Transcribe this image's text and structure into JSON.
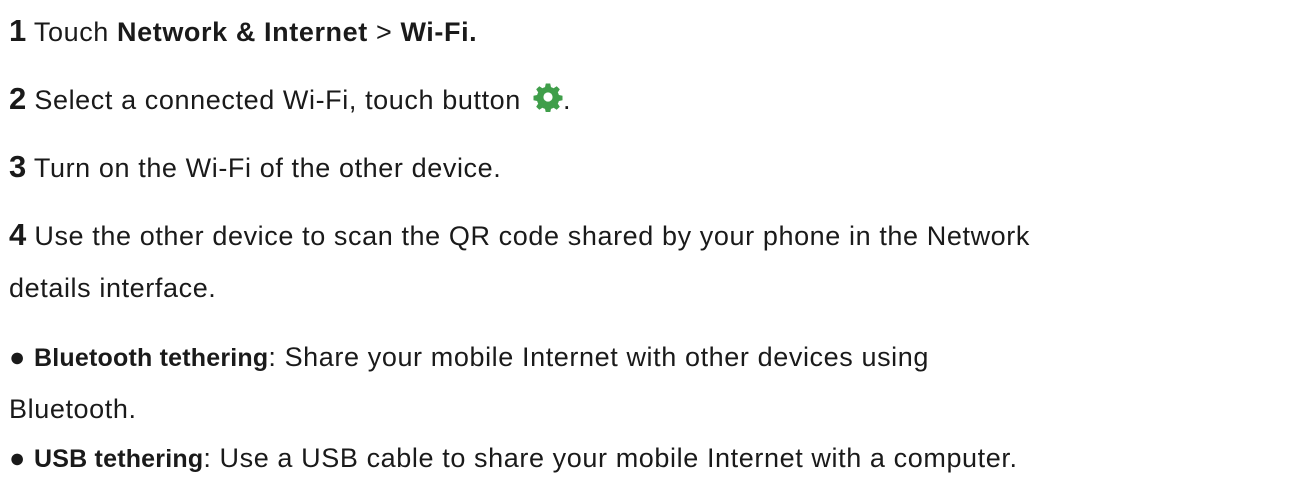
{
  "steps": [
    {
      "number": "1",
      "text_before": " Touch ",
      "bold_1": "Network & Internet",
      "text_mid": " > ",
      "bold_2": "Wi-Fi."
    },
    {
      "number": "2",
      "text": " Select a connected Wi-Fi, touch button ",
      "icon": "gear-icon",
      "text_after": "."
    },
    {
      "number": "3",
      "text": " Turn on the Wi-Fi of the other device."
    },
    {
      "number": "4",
      "text_line1": " Use the other device to scan the QR code shared by your phone in the Network",
      "text_line2": "details interface."
    }
  ],
  "bullets": [
    {
      "marker": "●",
      "label": "Bluetooth tethering",
      "text_line1": ": Share your mobile Internet with other devices using",
      "text_line2": "Bluetooth."
    },
    {
      "marker": "●",
      "label": "USB tethering",
      "text_line1": ": Use a USB cable to share your mobile Internet with a computer."
    }
  ],
  "colors": {
    "text": "#1a1a1a",
    "gear_icon": "#3f9e4a"
  }
}
